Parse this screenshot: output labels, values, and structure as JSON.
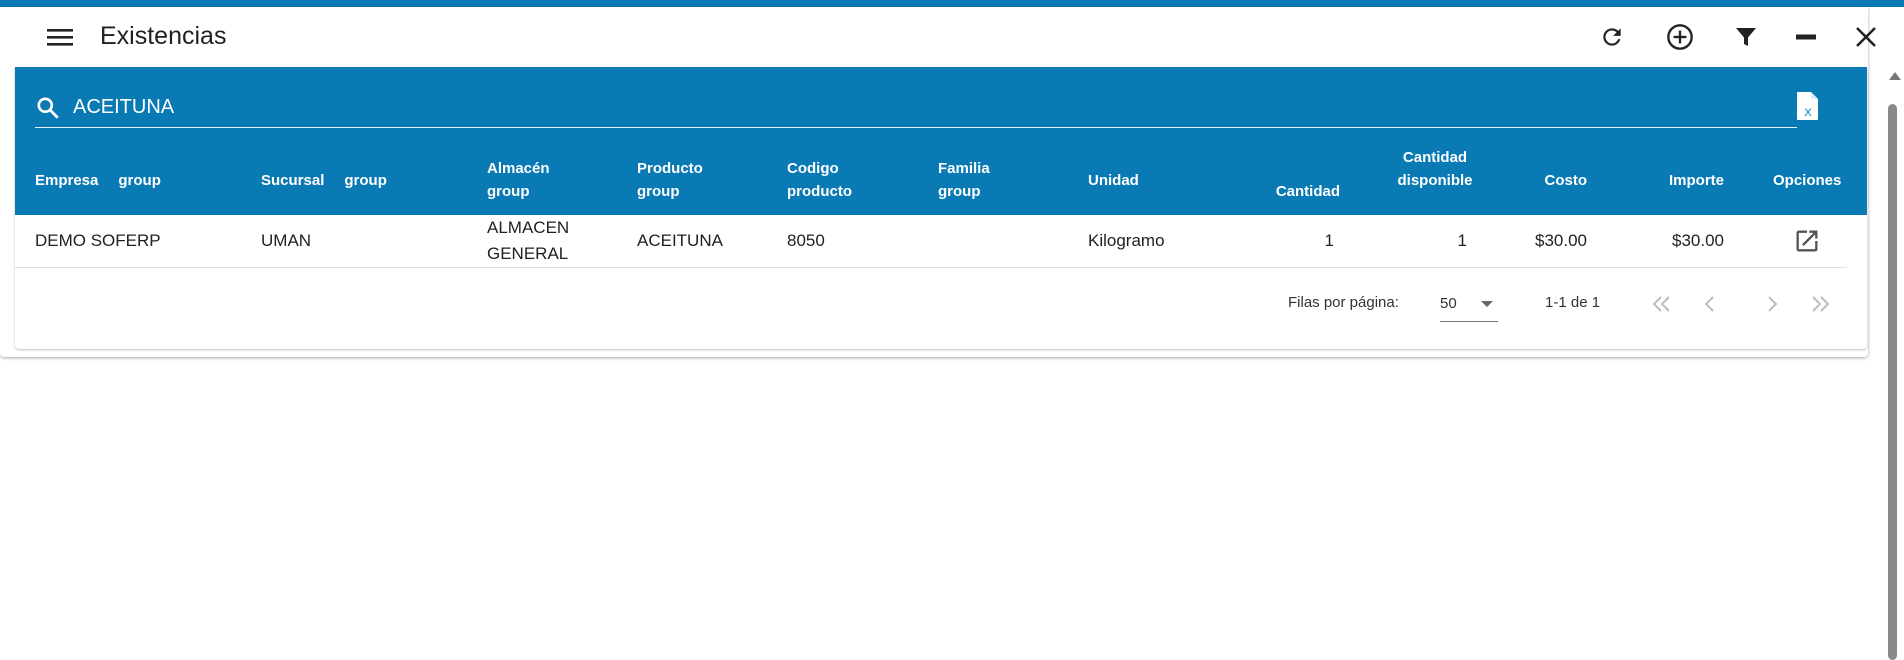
{
  "window": {
    "title": "Existencias"
  },
  "toolbar": {
    "menu_icon": "menu-icon",
    "refresh_icon": "refresh-icon",
    "add_icon": "add-circle-icon",
    "filter_icon": "filter-icon",
    "minimize_icon": "minimize-icon",
    "close_icon": "close-icon"
  },
  "search": {
    "value": "ACEITUNA",
    "icon": "search-icon",
    "export_icon": "excel-file-icon"
  },
  "table": {
    "headers": {
      "empresa": "Empresa",
      "empresa_group": "group",
      "sucursal": "Sucursal",
      "sucursal_group": "group",
      "almacen": "Almacén",
      "almacen_group": "group",
      "producto": "Producto",
      "producto_group": "group",
      "codigo_1": "Codigo",
      "codigo_2": "producto",
      "familia": "Familia",
      "familia_group": "group",
      "unidad": "Unidad",
      "cantidad": "Cantidad",
      "disponible_1": "Cantidad",
      "disponible_2": "disponible",
      "costo": "Costo",
      "importe": "Importe",
      "opciones": "Opciones"
    },
    "rows": [
      {
        "empresa": "DEMO SOFERP",
        "sucursal": "UMAN",
        "almacen_1": "ALMACEN",
        "almacen_2": "GENERAL",
        "producto": "ACEITUNA",
        "codigo": "8050",
        "familia": "",
        "unidad": "Kilogramo",
        "cantidad": "1",
        "disponible": "1",
        "costo": "$30.00",
        "importe": "$30.00",
        "option_icon": "open-in-new-icon"
      }
    ]
  },
  "pagination": {
    "rows_per_page_label": "Filas por página:",
    "rows_per_page": "50",
    "range": "1-1 de 1"
  },
  "colors": {
    "accent": "#0a7ab5",
    "text": "#212121"
  }
}
